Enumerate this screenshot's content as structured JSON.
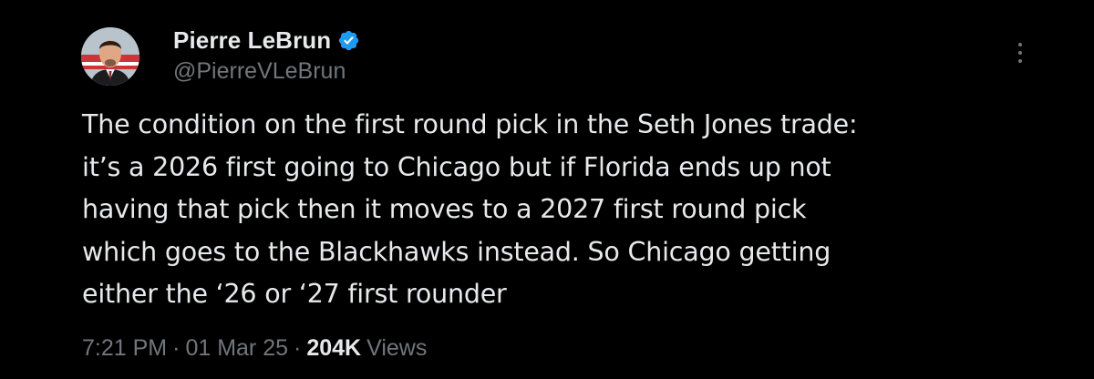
{
  "author": {
    "display_name": "Pierre LeBrun",
    "handle": "@PierreVLeBrun",
    "verified": true,
    "verified_color": "#1d9bf0"
  },
  "tweet": {
    "text": "The condition on the first round pick in the Seth Jones trade:\nit’s a 2026 first going to Chicago but if Florida ends up not\nhaving that pick then it moves to a 2027 first round pick\nwhich goes to the Blackhawks instead. So Chicago getting\neither the ‘26 or ‘27 first rounder"
  },
  "meta": {
    "time": "7:21 PM",
    "separator": "·",
    "date": "01 Mar 25",
    "views_count": "204K",
    "views_label": "Views"
  },
  "icons": {
    "more": "more-vertical-icon",
    "verified": "verified-badge-icon"
  },
  "colors": {
    "background": "#000000",
    "primary_text": "#e7e9ea",
    "secondary_text": "#71767b"
  }
}
